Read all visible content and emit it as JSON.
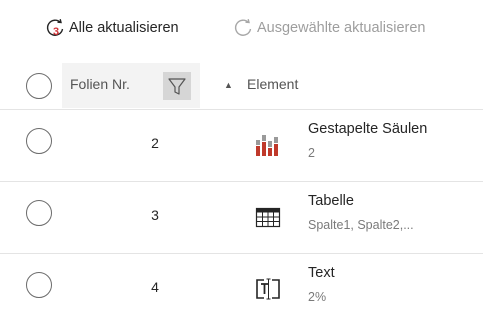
{
  "toolbar": {
    "refresh_all_label": "Alle aktualisieren",
    "refresh_all_badge": "3",
    "refresh_selected_label": "Ausgewählte aktualisieren"
  },
  "table": {
    "columns": {
      "slide_no": "Folien Nr.",
      "element": "Element"
    },
    "sort": "ascending",
    "rows": [
      {
        "slide_no": "2",
        "element": "Gestapelte Säulen",
        "detail": "2",
        "icon": "stacked-column-chart-icon"
      },
      {
        "slide_no": "3",
        "element": "Tabelle",
        "detail": "Spalte1, Spalte2,...",
        "icon": "table-icon"
      },
      {
        "slide_no": "4",
        "element": "Text",
        "detail": "2%",
        "icon": "text-box-icon"
      }
    ]
  },
  "colors": {
    "badge_red": "#d13438",
    "chart_red": "#c0392b",
    "chart_grey": "#9a9a9a",
    "filter_bg": "#d6d6d6",
    "header_bg": "#f3f3f3"
  }
}
